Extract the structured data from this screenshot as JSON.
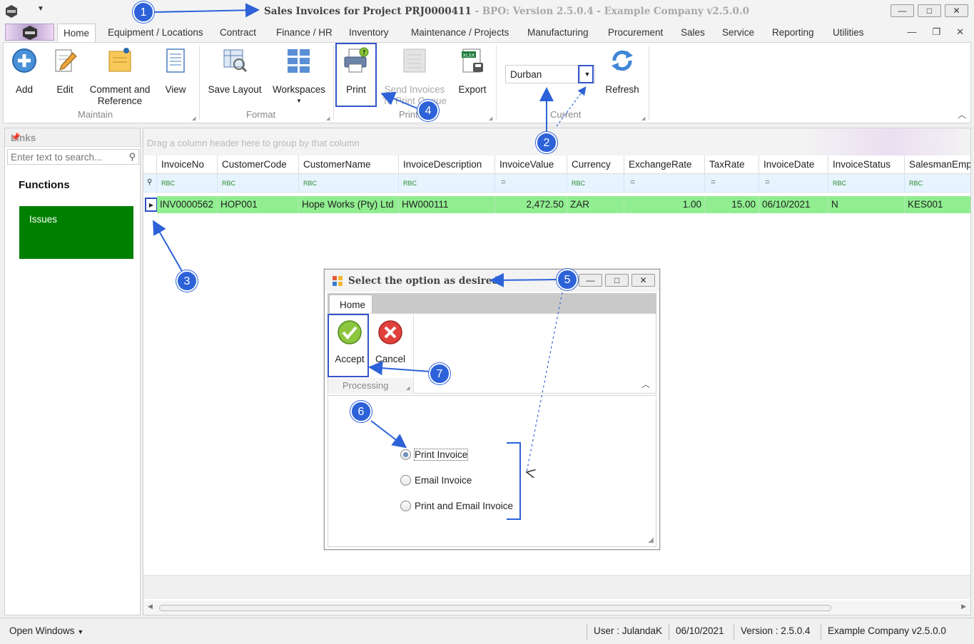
{
  "window": {
    "title": "Sales Invoices for Project PRJ0000411",
    "version_text": " - BPO: Version 2.5.0.4 - Example Company v2.5.0.0",
    "buttons": [
      "—",
      "□",
      "✕"
    ]
  },
  "menu": {
    "tabs": [
      "Home",
      "Equipment / Locations",
      "Contract",
      "Finance / HR",
      "Inventory",
      "Maintenance / Projects",
      "Manufacturing",
      "Procurement",
      "Sales",
      "Service",
      "Reporting",
      "Utilities"
    ],
    "mdi_buttons": [
      "—",
      "❐",
      "✕"
    ]
  },
  "ribbon": {
    "add": "Add",
    "edit": "Edit",
    "comment_line1": "Comment and",
    "comment_line2": "Reference",
    "view": "View",
    "maintain_group": "Maintain",
    "save_layout": "Save Layout",
    "workspaces": "Workspaces",
    "format_group": "Format",
    "print": "Print",
    "send_line1": "Send Invoices",
    "send_line2": "To Print Queue",
    "export": "Export",
    "print_group": "Print",
    "site_value": "Durban",
    "refresh": "Refresh",
    "current_group": "Current"
  },
  "links": {
    "header": "Links",
    "search_placeholder": "Enter text to search...",
    "functions_title": "Functions",
    "issues": "Issues"
  },
  "grid": {
    "group_hint": "Drag a column header here to group by that column",
    "columns": [
      "InvoiceNo",
      "CustomerCode",
      "CustomerName",
      "InvoiceDescription",
      "InvoiceValue",
      "Currency",
      "ExchangeRate",
      "TaxRate",
      "InvoiceDate",
      "InvoiceStatus",
      "SalesmanEmplNo"
    ],
    "filter_types": [
      "RBC",
      "RBC",
      "RBC",
      "RBC",
      "=",
      "RBC",
      "=",
      "=",
      "=",
      "RBC",
      "RBC"
    ],
    "rows": [
      [
        "INV0000562",
        "HOP001",
        "Hope Works (Pty) Ltd",
        "HW000111",
        "2,472.50",
        "ZAR",
        "1.00",
        "15.00",
        "06/10/2021",
        "N",
        "KES001"
      ]
    ]
  },
  "status": {
    "open_windows": "Open Windows",
    "user": "User : JulandaK",
    "date": "06/10/2021",
    "version": "Version : 2.5.0.4",
    "company": "Example Company v2.5.0.0"
  },
  "dialog": {
    "title": "Select the option as desired",
    "tab": "Home",
    "accept": "Accept",
    "cancel": "Cancel",
    "group": "Processing",
    "options": [
      "Print Invoice",
      "Email Invoice",
      "Print and Email Invoice"
    ],
    "selected_option": "Print Invoice"
  },
  "annotations": [
    "1",
    "2",
    "3",
    "4",
    "5",
    "6",
    "7"
  ],
  "colors": {
    "accent": "#2d62d8",
    "row_highlight": "#90ee90",
    "issues_tile": "#008000"
  }
}
